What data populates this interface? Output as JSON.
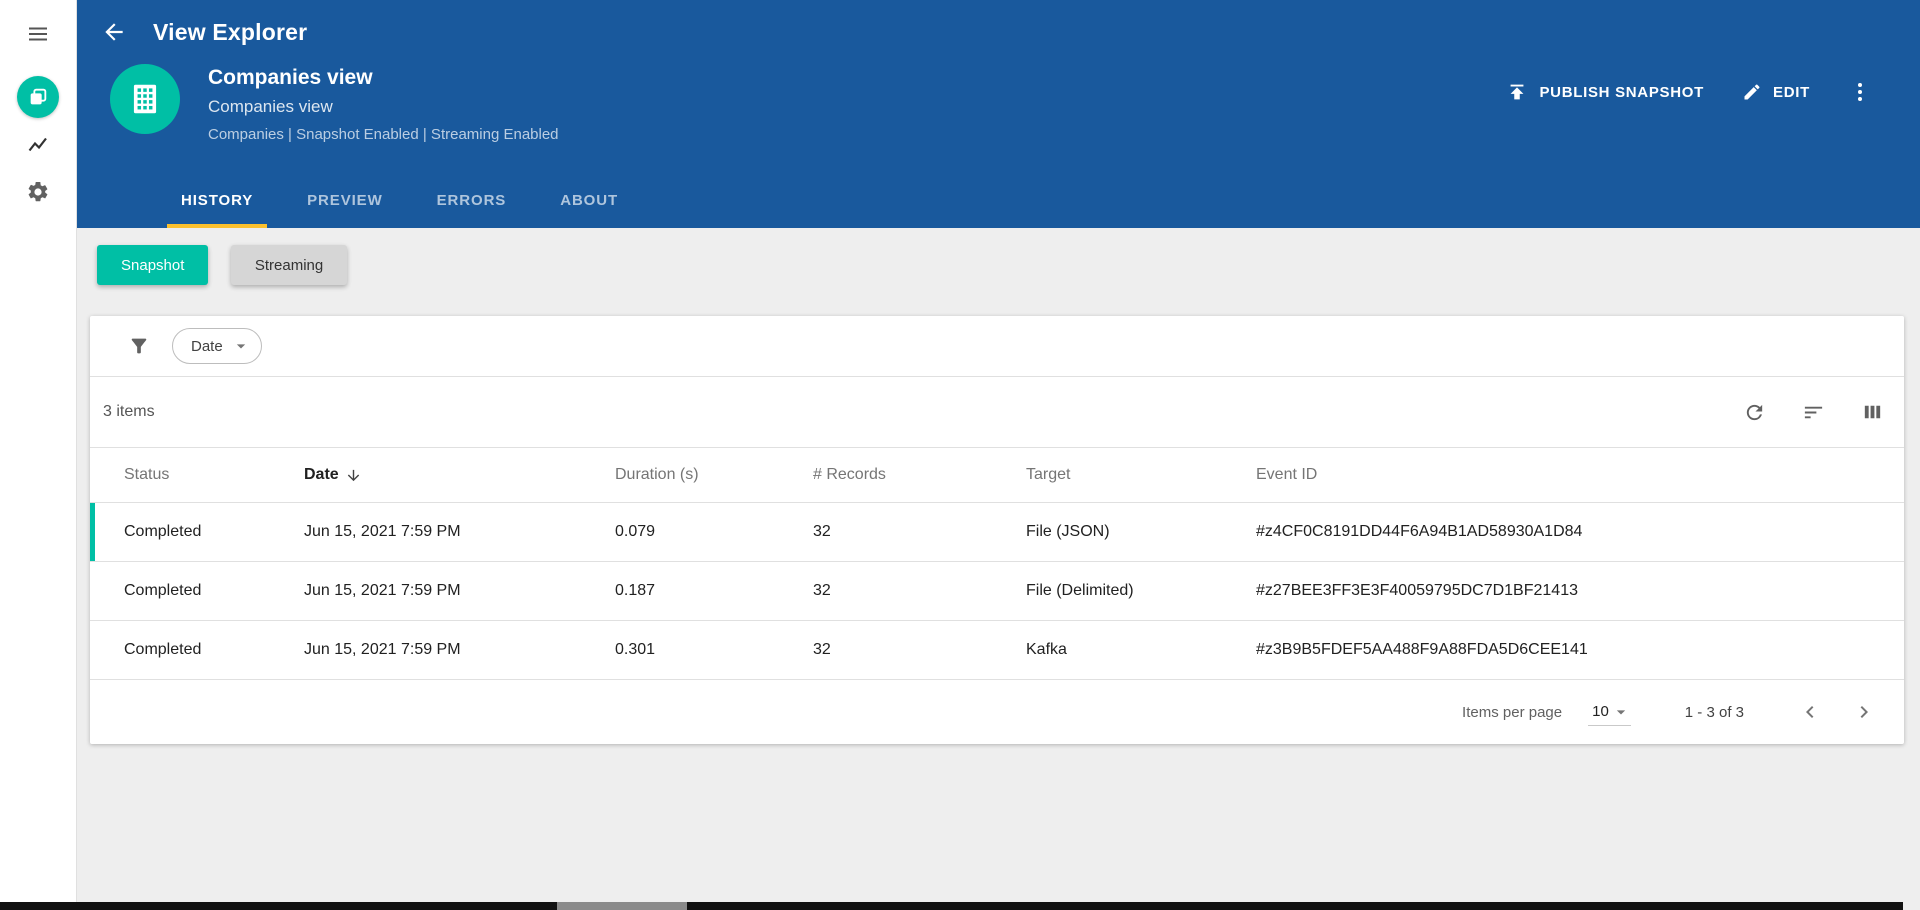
{
  "app": {
    "title": "View Explorer"
  },
  "entity": {
    "title": "Companies view",
    "subtitle": "Companies view",
    "meta": "Companies | Snapshot Enabled | Streaming Enabled"
  },
  "actions": {
    "publish": "PUBLISH SNAPSHOT",
    "edit": "EDIT"
  },
  "tabs": {
    "history": "HISTORY",
    "preview": "PREVIEW",
    "errors": "ERRORS",
    "about": "ABOUT"
  },
  "toggles": {
    "snapshot": "Snapshot",
    "streaming": "Streaming"
  },
  "filter": {
    "date_label": "Date"
  },
  "table": {
    "items_count": "3 items",
    "columns": {
      "status": "Status",
      "date": "Date",
      "duration": "Duration (s)",
      "records": "# Records",
      "target": "Target",
      "event_id": "Event ID"
    },
    "rows": [
      {
        "status": "Completed",
        "date": "Jun 15, 2021 7:59 PM",
        "duration": "0.079",
        "records": "32",
        "target": "File (JSON)",
        "event_id": "#z4CF0C8191DD44F6A94B1AD58930A1D84"
      },
      {
        "status": "Completed",
        "date": "Jun 15, 2021 7:59 PM",
        "duration": "0.187",
        "records": "32",
        "target": "File (Delimited)",
        "event_id": "#z27BEE3FF3E3F40059795DC7D1BF21413"
      },
      {
        "status": "Completed",
        "date": "Jun 15, 2021 7:59 PM",
        "duration": "0.301",
        "records": "32",
        "target": "Kafka",
        "event_id": "#z3B9B5FDEF5AA488F9A88FDA5D6CEE141"
      }
    ]
  },
  "pagination": {
    "items_per_page_label": "Items per page",
    "items_per_page_value": "10",
    "range_label": "1 - 3 of 3"
  },
  "icons": {
    "menu": "hamburger",
    "views": "overlapping-squares",
    "analytics": "line-chart",
    "settings": "gear",
    "back": "arrow-left",
    "publish": "upload-tray",
    "edit": "pencil",
    "more": "kebab",
    "filter": "funnel",
    "sort_direction": "arrow-down",
    "refresh": "circular-arrow",
    "sort": "descending-lines",
    "columns": "vertical-bars",
    "dropdown": "caret-down",
    "page_prev": "chevron-left",
    "page_next": "chevron-right"
  },
  "colors": {
    "header_blue": "#19599d",
    "accent_teal": "#00bfa5",
    "tab_underline_amber": "#fbc02d",
    "content_bg": "#eeeeee"
  }
}
